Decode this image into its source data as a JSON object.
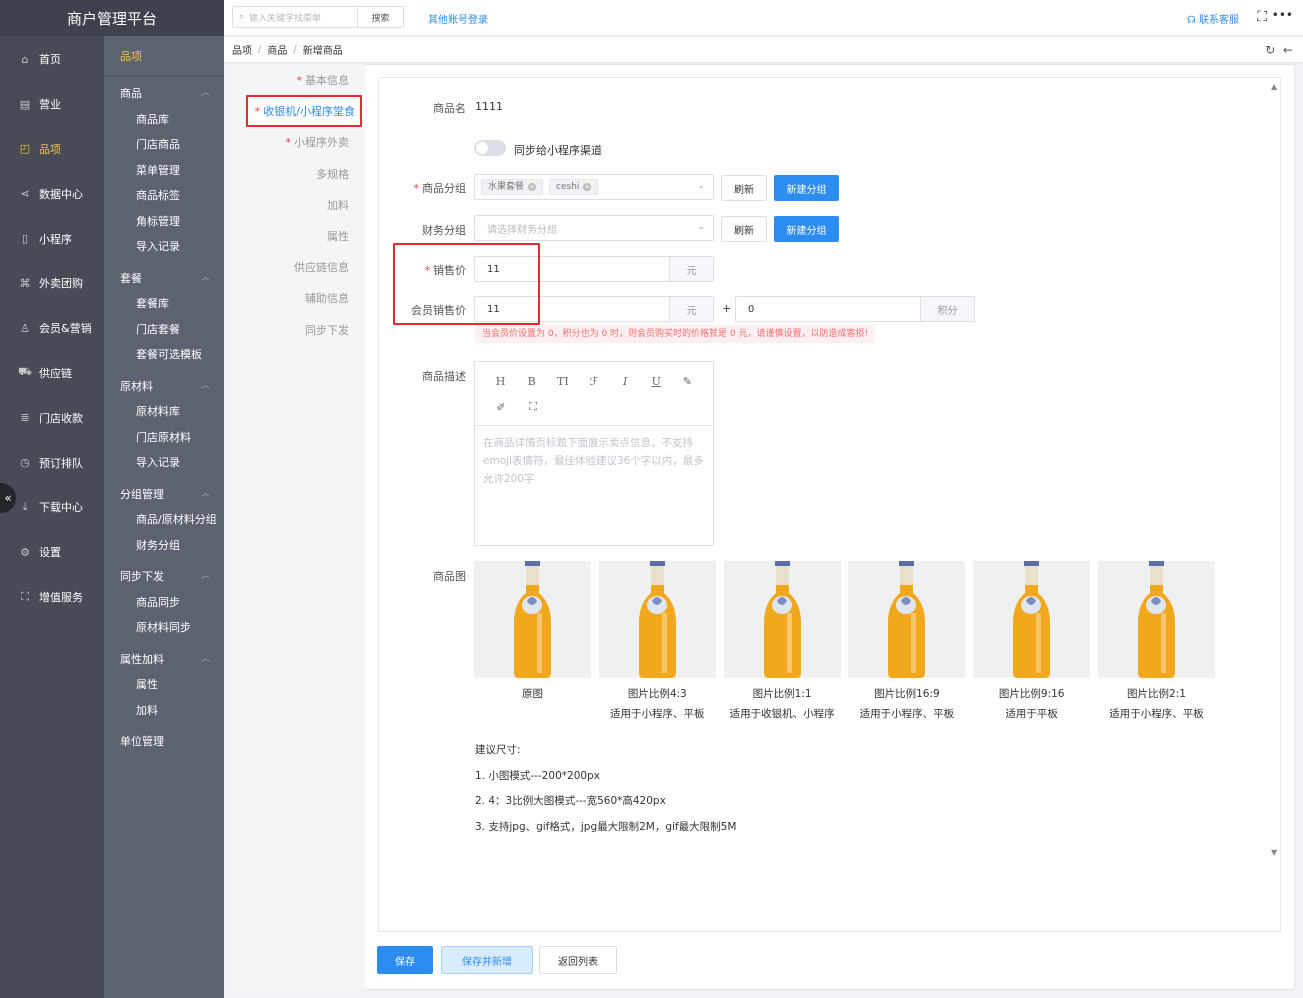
{
  "app": {
    "title": "商户管理平台"
  },
  "nav1": {
    "items": [
      {
        "label": "首页",
        "icon": "home-icon",
        "glyph": "⌂"
      },
      {
        "label": "营业",
        "icon": "calendar-icon",
        "glyph": "▤"
      },
      {
        "label": "品项",
        "icon": "bag-icon",
        "glyph": "◰"
      },
      {
        "label": "数据中心",
        "icon": "share-icon",
        "glyph": "⋖"
      },
      {
        "label": "小程序",
        "icon": "phone-icon",
        "glyph": "▯"
      },
      {
        "label": "外卖团购",
        "icon": "bike-icon",
        "glyph": "⌘"
      },
      {
        "label": "会员&营销",
        "icon": "user-icon",
        "glyph": "♙"
      },
      {
        "label": "供应链",
        "icon": "truck-icon",
        "glyph": "⛟"
      },
      {
        "label": "门店收款",
        "icon": "database-icon",
        "glyph": "≣"
      },
      {
        "label": "预订排队",
        "icon": "clock-icon",
        "glyph": "◷"
      },
      {
        "label": "下载中心",
        "icon": "download-icon",
        "glyph": "⤓"
      },
      {
        "label": "设置",
        "icon": "gear-icon",
        "glyph": "⚙"
      },
      {
        "label": "增值服务",
        "icon": "gift-icon",
        "glyph": "⛶"
      }
    ],
    "collapse_glyph": "«"
  },
  "nav2": {
    "header": "品项",
    "groups": [
      {
        "label": "商品",
        "items": [
          "商品库",
          "门店商品",
          "菜单管理",
          "商品标签",
          "角标管理",
          "导入记录"
        ]
      },
      {
        "label": "套餐",
        "items": [
          "套餐库",
          "门店套餐",
          "套餐可选模板"
        ]
      },
      {
        "label": "原材料",
        "items": [
          "原材料库",
          "门店原材料",
          "导入记录"
        ]
      },
      {
        "label": "分组管理",
        "items": [
          "商品/原材料分组",
          "财务分组"
        ]
      },
      {
        "label": "同步下发",
        "items": [
          "商品同步",
          "原材料同步"
        ]
      },
      {
        "label": "属性加料",
        "items": [
          "属性",
          "加料"
        ]
      },
      {
        "label": "单位管理",
        "items": []
      }
    ]
  },
  "topbar": {
    "search_placeholder": "输入关键字找菜单",
    "search_button": "搜索",
    "other_login": "其他账号登录",
    "contact": "联系客服"
  },
  "breadcrumb": [
    "品项",
    "商品",
    "新增商品"
  ],
  "steps": [
    {
      "label": "基本信息",
      "required": true
    },
    {
      "label": "收银机/小程序堂食",
      "required": true,
      "active": true
    },
    {
      "label": "小程序外卖",
      "required": true
    },
    {
      "label": "多规格",
      "required": false
    },
    {
      "label": "加料",
      "required": false
    },
    {
      "label": "属性",
      "required": false
    },
    {
      "label": "供应链信息",
      "required": false
    },
    {
      "label": "辅助信息",
      "required": false
    },
    {
      "label": "同步下发",
      "required": false
    }
  ],
  "form": {
    "name_label": "商品名",
    "name_value": "1111",
    "sync_label": "同步给小程序渠道",
    "sync_on": false,
    "group_label": "商品分组",
    "group_tags": [
      "水果套餐",
      "ceshi"
    ],
    "refresh": "刷新",
    "new_group": "新建分组",
    "finance_label": "财务分组",
    "finance_placeholder": "请选择财务分组",
    "price_label": "销售价",
    "price_value": "11",
    "price_unit": "元",
    "member_label": "会员销售价",
    "member_value": "11",
    "member_unit": "元",
    "plus": "+",
    "points_value": "0",
    "points_unit": "积分",
    "warning": "当会员价设置为 0，积分也为 0 时，则会员购买时的价格就是 0 元，请谨慎设置，以防造成客损!",
    "desc_label": "商品描述",
    "desc_placeholder": "在商品详情页标题下面展示卖点信息，不支持emoji表情符，最佳体验建议36个字以内，最多允许200字",
    "tools_row1": [
      "H",
      "B",
      "TI",
      "ℱ",
      "I",
      "U",
      "✎"
    ],
    "tools_row2": [
      "✐",
      "⛶"
    ],
    "pic_label": "商品图",
    "pictures": [
      {
        "line1": "原图",
        "line2": ""
      },
      {
        "line1": "图片比例4:3",
        "line2": "适用于小程序、平板"
      },
      {
        "line1": "图片比例1:1",
        "line2": "适用于收银机、小程序"
      },
      {
        "line1": "图片比例16:9",
        "line2": "适用于小程序、平板"
      },
      {
        "line1": "图片比例9:16",
        "line2": "适用于平板"
      },
      {
        "line1": "图片比例2:1",
        "line2": "适用于小程序、平板"
      }
    ],
    "tips_title": "建议尺寸:",
    "tips": [
      "1. 小图模式---200*200px",
      "2. 4：3比例大图模式---宽560*高420px",
      "3. 支持jpg、gif格式，jpg最大限制2M，gif最大限制5M"
    ]
  },
  "footer": {
    "save": "保存",
    "save_new": "保存并新增",
    "back": "返回列表"
  },
  "colors": {
    "primary": "#2d8cf0",
    "active_nav": "#f7c548",
    "highlight": "#e02e2e",
    "bottle": "#f2a81d"
  }
}
